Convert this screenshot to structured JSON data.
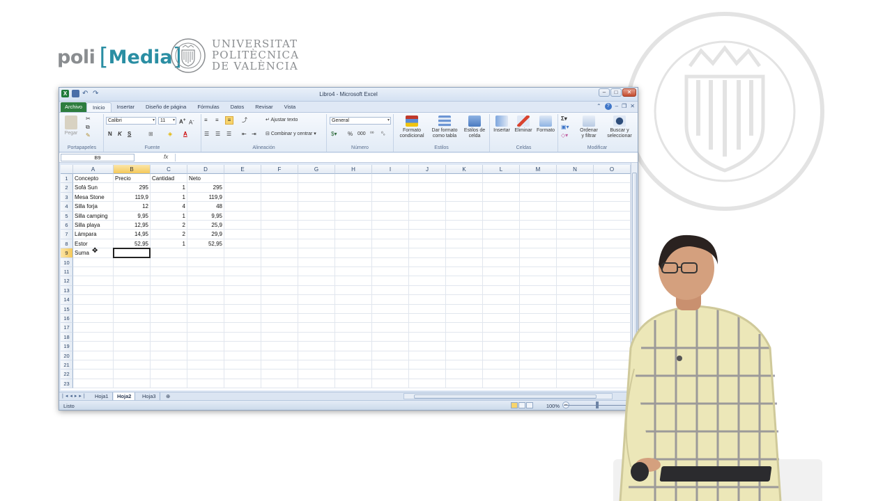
{
  "branding": {
    "poli": "poli",
    "media": "Media",
    "upv_lines": [
      "UNIVERSITAT",
      "POLITÈCNICA",
      "DE VALÈNCIA"
    ]
  },
  "window": {
    "title": "Libro4 - Microsoft Excel",
    "tabs": [
      "Archivo",
      "Inicio",
      "Insertar",
      "Diseño de página",
      "Fórmulas",
      "Datos",
      "Revisar",
      "Vista"
    ],
    "active_tab": "Inicio"
  },
  "ribbon": {
    "portapapeles": {
      "label": "Portapapeles",
      "pegar": "Pegar"
    },
    "fuente": {
      "label": "Fuente",
      "font": "Calibri",
      "size": "11",
      "bold": "N",
      "italic": "K",
      "underline": "S"
    },
    "alineacion": {
      "label": "Alineación",
      "ajustar": "Ajustar texto",
      "combinar": "Combinar y centrar"
    },
    "numero": {
      "label": "Número",
      "format": "General",
      "percent": "%",
      "thousands": "000"
    },
    "estilos": {
      "label": "Estilos",
      "formato_condicional": [
        "Formato",
        "condicional"
      ],
      "dar_formato": [
        "Dar formato",
        "como tabla"
      ],
      "estilos_celda": [
        "Estilos de",
        "celda"
      ]
    },
    "celdas": {
      "label": "Celdas",
      "insertar": "Insertar",
      "eliminar": "Eliminar",
      "formato": "Formato"
    },
    "modificar": {
      "label": "Modificar",
      "ordenar": [
        "Ordenar",
        "y filtrar"
      ],
      "buscar": [
        "Buscar y",
        "seleccionar"
      ]
    }
  },
  "formula_bar": {
    "name_box": "B9",
    "fx": "fx",
    "value": ""
  },
  "columns": [
    "A",
    "B",
    "C",
    "D",
    "E",
    "F",
    "G",
    "H",
    "I",
    "J",
    "K",
    "L",
    "M",
    "N",
    "O"
  ],
  "selected_column": "B",
  "rows": [
    "1",
    "2",
    "3",
    "4",
    "5",
    "6",
    "7",
    "8",
    "9",
    "10",
    "11",
    "12",
    "13",
    "14",
    "15",
    "16",
    "17",
    "18",
    "19",
    "20",
    "21",
    "22",
    "23"
  ],
  "selected_row": "9",
  "cells": [
    [
      "Concepto",
      "Precio",
      "Cantidad",
      "Neto"
    ],
    [
      "Sofá Sun",
      "295",
      "1",
      "295"
    ],
    [
      "Mesa Stone",
      "119,9",
      "1",
      "119,9"
    ],
    [
      "Silla forja",
      "12",
      "4",
      "48"
    ],
    [
      "Silla camping",
      "9,95",
      "1",
      "9,95"
    ],
    [
      "Silla playa",
      "12,95",
      "2",
      "25,9"
    ],
    [
      "Lámpara",
      "14,95",
      "2",
      "29,9"
    ],
    [
      "Estor",
      "52,95",
      "1",
      "52,95"
    ],
    [
      "Suma",
      "",
      "",
      ""
    ]
  ],
  "sheets": [
    "Hoja1",
    "Hoja2",
    "Hoja3"
  ],
  "active_sheet": "Hoja2",
  "status": {
    "mode": "Listo",
    "zoom": "100%"
  },
  "colors": {
    "file_tab": "#2d7d3f",
    "selection_header": "#f5c95a",
    "brand_teal": "#2a8ea3",
    "brand_gray": "#8a8d90"
  }
}
